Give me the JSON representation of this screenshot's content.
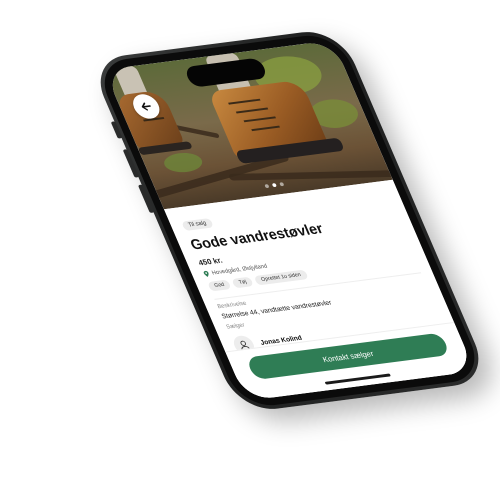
{
  "listing": {
    "tag": "Til salg",
    "title": "Gode vandrestøvler",
    "price": "450 kr.",
    "location": "Hovedgård, Østjylland",
    "chips": [
      "God",
      "Tøj",
      "Oprettet 1u siden"
    ],
    "description_label": "Beskrivelse",
    "description": "Størrelse 44, vandtætte vandrestøvler",
    "seller_label": "Sælger",
    "seller_name": "Jonas Kolind"
  },
  "actions": {
    "contact_label": "Kontakt sælger"
  },
  "gallery": {
    "image_count": 3,
    "active_index": 1
  },
  "colors": {
    "accent": "#2f7d55",
    "phone_frame": "#2a2b2b"
  },
  "icons": {
    "back": "arrow-left-icon",
    "location": "map-pin-icon",
    "avatar": "user-icon"
  }
}
